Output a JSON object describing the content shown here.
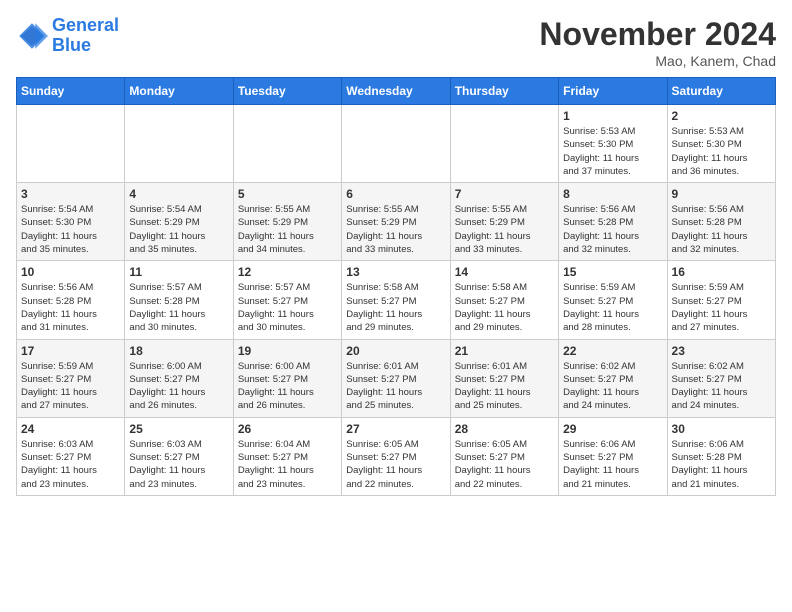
{
  "logo": {
    "line1": "General",
    "line2": "Blue"
  },
  "header": {
    "month": "November 2024",
    "location": "Mao, Kanem, Chad"
  },
  "weekdays": [
    "Sunday",
    "Monday",
    "Tuesday",
    "Wednesday",
    "Thursday",
    "Friday",
    "Saturday"
  ],
  "weeks": [
    [
      {
        "day": "",
        "info": ""
      },
      {
        "day": "",
        "info": ""
      },
      {
        "day": "",
        "info": ""
      },
      {
        "day": "",
        "info": ""
      },
      {
        "day": "",
        "info": ""
      },
      {
        "day": "1",
        "info": "Sunrise: 5:53 AM\nSunset: 5:30 PM\nDaylight: 11 hours\nand 37 minutes."
      },
      {
        "day": "2",
        "info": "Sunrise: 5:53 AM\nSunset: 5:30 PM\nDaylight: 11 hours\nand 36 minutes."
      }
    ],
    [
      {
        "day": "3",
        "info": "Sunrise: 5:54 AM\nSunset: 5:30 PM\nDaylight: 11 hours\nand 35 minutes."
      },
      {
        "day": "4",
        "info": "Sunrise: 5:54 AM\nSunset: 5:29 PM\nDaylight: 11 hours\nand 35 minutes."
      },
      {
        "day": "5",
        "info": "Sunrise: 5:55 AM\nSunset: 5:29 PM\nDaylight: 11 hours\nand 34 minutes."
      },
      {
        "day": "6",
        "info": "Sunrise: 5:55 AM\nSunset: 5:29 PM\nDaylight: 11 hours\nand 33 minutes."
      },
      {
        "day": "7",
        "info": "Sunrise: 5:55 AM\nSunset: 5:29 PM\nDaylight: 11 hours\nand 33 minutes."
      },
      {
        "day": "8",
        "info": "Sunrise: 5:56 AM\nSunset: 5:28 PM\nDaylight: 11 hours\nand 32 minutes."
      },
      {
        "day": "9",
        "info": "Sunrise: 5:56 AM\nSunset: 5:28 PM\nDaylight: 11 hours\nand 32 minutes."
      }
    ],
    [
      {
        "day": "10",
        "info": "Sunrise: 5:56 AM\nSunset: 5:28 PM\nDaylight: 11 hours\nand 31 minutes."
      },
      {
        "day": "11",
        "info": "Sunrise: 5:57 AM\nSunset: 5:28 PM\nDaylight: 11 hours\nand 30 minutes."
      },
      {
        "day": "12",
        "info": "Sunrise: 5:57 AM\nSunset: 5:27 PM\nDaylight: 11 hours\nand 30 minutes."
      },
      {
        "day": "13",
        "info": "Sunrise: 5:58 AM\nSunset: 5:27 PM\nDaylight: 11 hours\nand 29 minutes."
      },
      {
        "day": "14",
        "info": "Sunrise: 5:58 AM\nSunset: 5:27 PM\nDaylight: 11 hours\nand 29 minutes."
      },
      {
        "day": "15",
        "info": "Sunrise: 5:59 AM\nSunset: 5:27 PM\nDaylight: 11 hours\nand 28 minutes."
      },
      {
        "day": "16",
        "info": "Sunrise: 5:59 AM\nSunset: 5:27 PM\nDaylight: 11 hours\nand 27 minutes."
      }
    ],
    [
      {
        "day": "17",
        "info": "Sunrise: 5:59 AM\nSunset: 5:27 PM\nDaylight: 11 hours\nand 27 minutes."
      },
      {
        "day": "18",
        "info": "Sunrise: 6:00 AM\nSunset: 5:27 PM\nDaylight: 11 hours\nand 26 minutes."
      },
      {
        "day": "19",
        "info": "Sunrise: 6:00 AM\nSunset: 5:27 PM\nDaylight: 11 hours\nand 26 minutes."
      },
      {
        "day": "20",
        "info": "Sunrise: 6:01 AM\nSunset: 5:27 PM\nDaylight: 11 hours\nand 25 minutes."
      },
      {
        "day": "21",
        "info": "Sunrise: 6:01 AM\nSunset: 5:27 PM\nDaylight: 11 hours\nand 25 minutes."
      },
      {
        "day": "22",
        "info": "Sunrise: 6:02 AM\nSunset: 5:27 PM\nDaylight: 11 hours\nand 24 minutes."
      },
      {
        "day": "23",
        "info": "Sunrise: 6:02 AM\nSunset: 5:27 PM\nDaylight: 11 hours\nand 24 minutes."
      }
    ],
    [
      {
        "day": "24",
        "info": "Sunrise: 6:03 AM\nSunset: 5:27 PM\nDaylight: 11 hours\nand 23 minutes."
      },
      {
        "day": "25",
        "info": "Sunrise: 6:03 AM\nSunset: 5:27 PM\nDaylight: 11 hours\nand 23 minutes."
      },
      {
        "day": "26",
        "info": "Sunrise: 6:04 AM\nSunset: 5:27 PM\nDaylight: 11 hours\nand 23 minutes."
      },
      {
        "day": "27",
        "info": "Sunrise: 6:05 AM\nSunset: 5:27 PM\nDaylight: 11 hours\nand 22 minutes."
      },
      {
        "day": "28",
        "info": "Sunrise: 6:05 AM\nSunset: 5:27 PM\nDaylight: 11 hours\nand 22 minutes."
      },
      {
        "day": "29",
        "info": "Sunrise: 6:06 AM\nSunset: 5:27 PM\nDaylight: 11 hours\nand 21 minutes."
      },
      {
        "day": "30",
        "info": "Sunrise: 6:06 AM\nSunset: 5:28 PM\nDaylight: 11 hours\nand 21 minutes."
      }
    ]
  ]
}
